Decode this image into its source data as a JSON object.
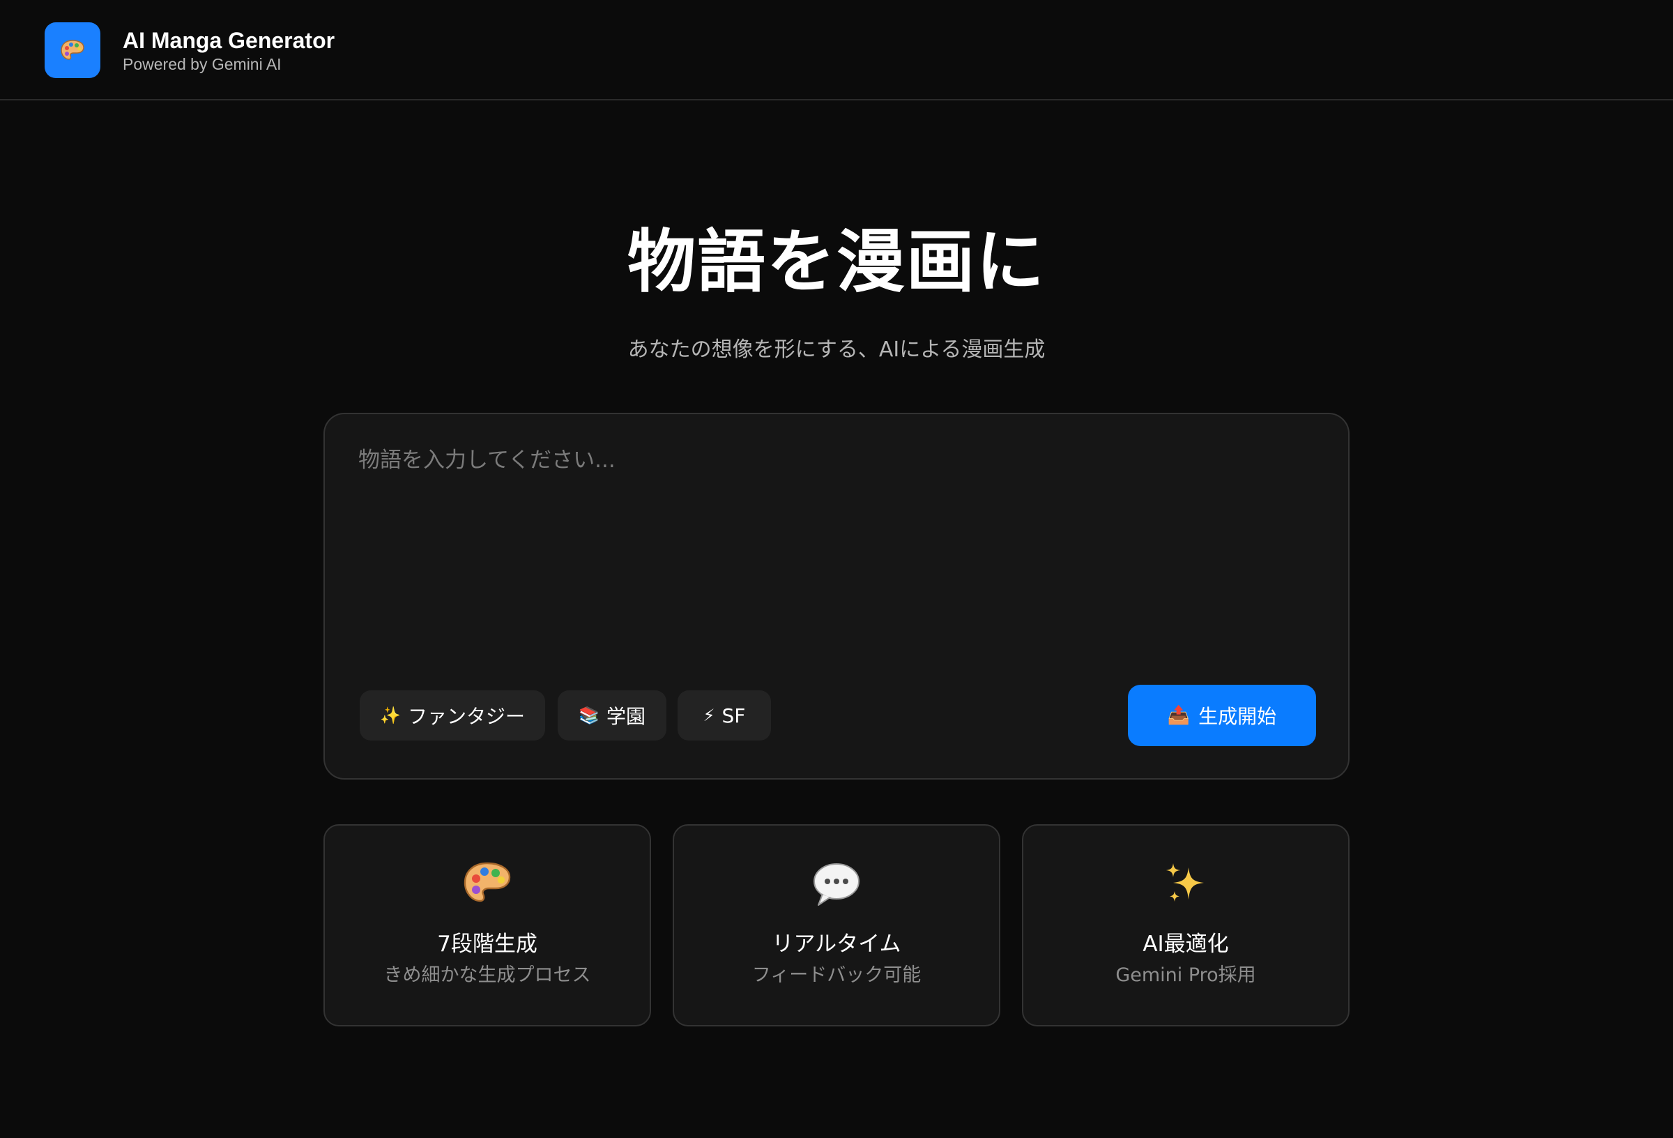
{
  "header": {
    "icon": "palette-icon",
    "title": "AI Manga Generator",
    "subtitle": "Powered by Gemini AI"
  },
  "hero": {
    "title": "物語を漫画に",
    "subtitle": "あなたの想像を形にする、AIによる漫画生成"
  },
  "story": {
    "value": "",
    "placeholder": "物語を入力してください..."
  },
  "genres": [
    {
      "icon": "sparkles-icon",
      "emoji": "✨",
      "label": "ファンタジー"
    },
    {
      "icon": "books-icon",
      "emoji": "📚",
      "label": "学園"
    },
    {
      "icon": "lightning-icon",
      "emoji": "⚡",
      "label": "SF"
    }
  ],
  "generate": {
    "icon": "outbox-tray-icon",
    "emoji": "📤",
    "label": "生成開始"
  },
  "features": [
    {
      "icon": "palette-icon",
      "title": "7段階生成",
      "desc": "きめ細かな生成プロセス"
    },
    {
      "icon": "speech-bubble-icon",
      "title": "リアルタイム",
      "desc": "フィードバック可能"
    },
    {
      "icon": "sparkles-icon",
      "title": "AI最適化",
      "desc": "Gemini Pro採用"
    }
  ],
  "colors": {
    "background": "#0b0b0b",
    "card": "#161616",
    "border": "#333333",
    "accent": "#0a7cff",
    "logo": "#1a80ff",
    "chip": "#232323",
    "muted_text": "#8e8e8e"
  }
}
